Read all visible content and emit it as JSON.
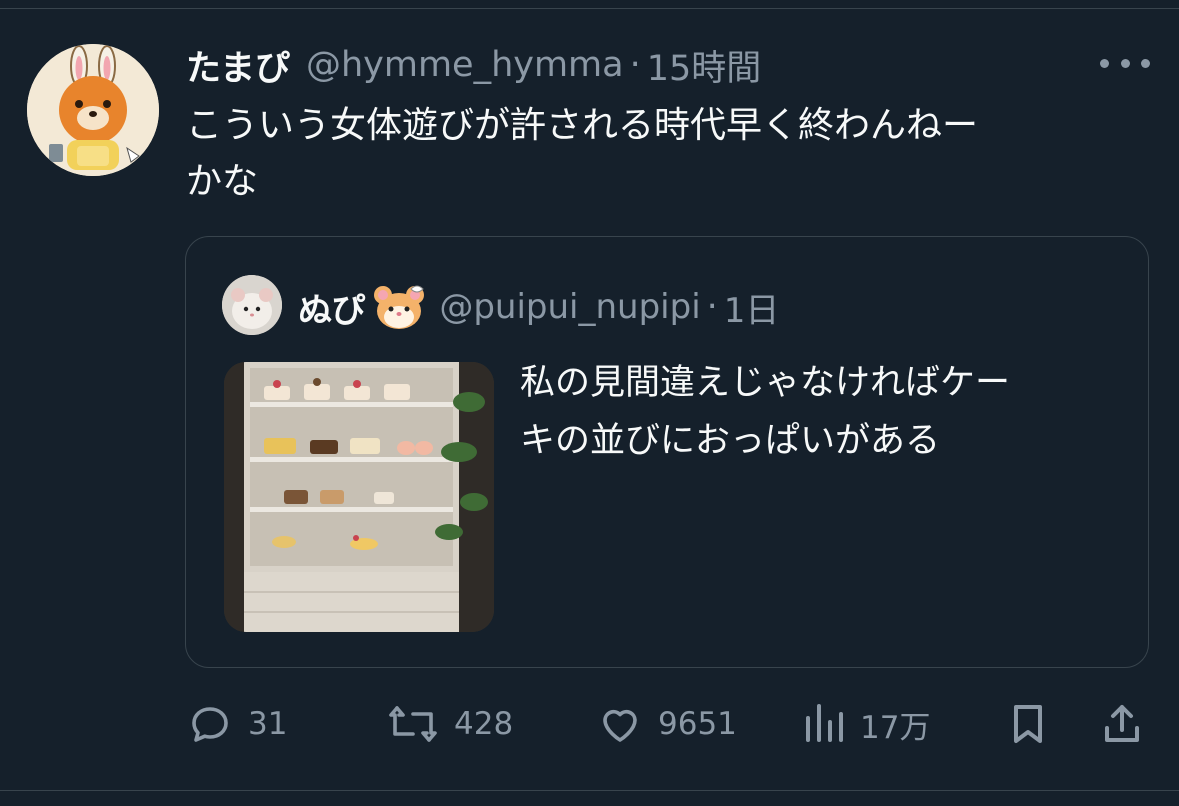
{
  "tweet": {
    "display_name": "たまぴ",
    "handle": "@hymme_hymma",
    "separator": "·",
    "time": "15時間",
    "text_line1": "こういう女体遊びが許される時代早く終わんねー",
    "text_line2": "かな"
  },
  "quoted": {
    "display_name": "ぬぴ",
    "handle": "@puipui_nupipi",
    "separator": "·",
    "time": "1日",
    "text_line1": "私の見間違えじゃなければケー",
    "text_line2": "キの並びにおっぱいがある"
  },
  "actions": {
    "reply_count": "31",
    "retweet_count": "428",
    "like_count": "9651",
    "views_count": "17万"
  },
  "icons": {
    "more": "more-dots-icon",
    "reply": "reply-icon",
    "retweet": "retweet-icon",
    "like": "heart-icon",
    "views": "views-icon",
    "bookmark": "bookmark-icon",
    "share": "share-icon",
    "emoji": "hamster-emoji"
  },
  "colors": {
    "background": "#15202b",
    "primary_text": "#f7f9f9",
    "secondary_text": "#8b98a5",
    "border": "#38444d"
  }
}
